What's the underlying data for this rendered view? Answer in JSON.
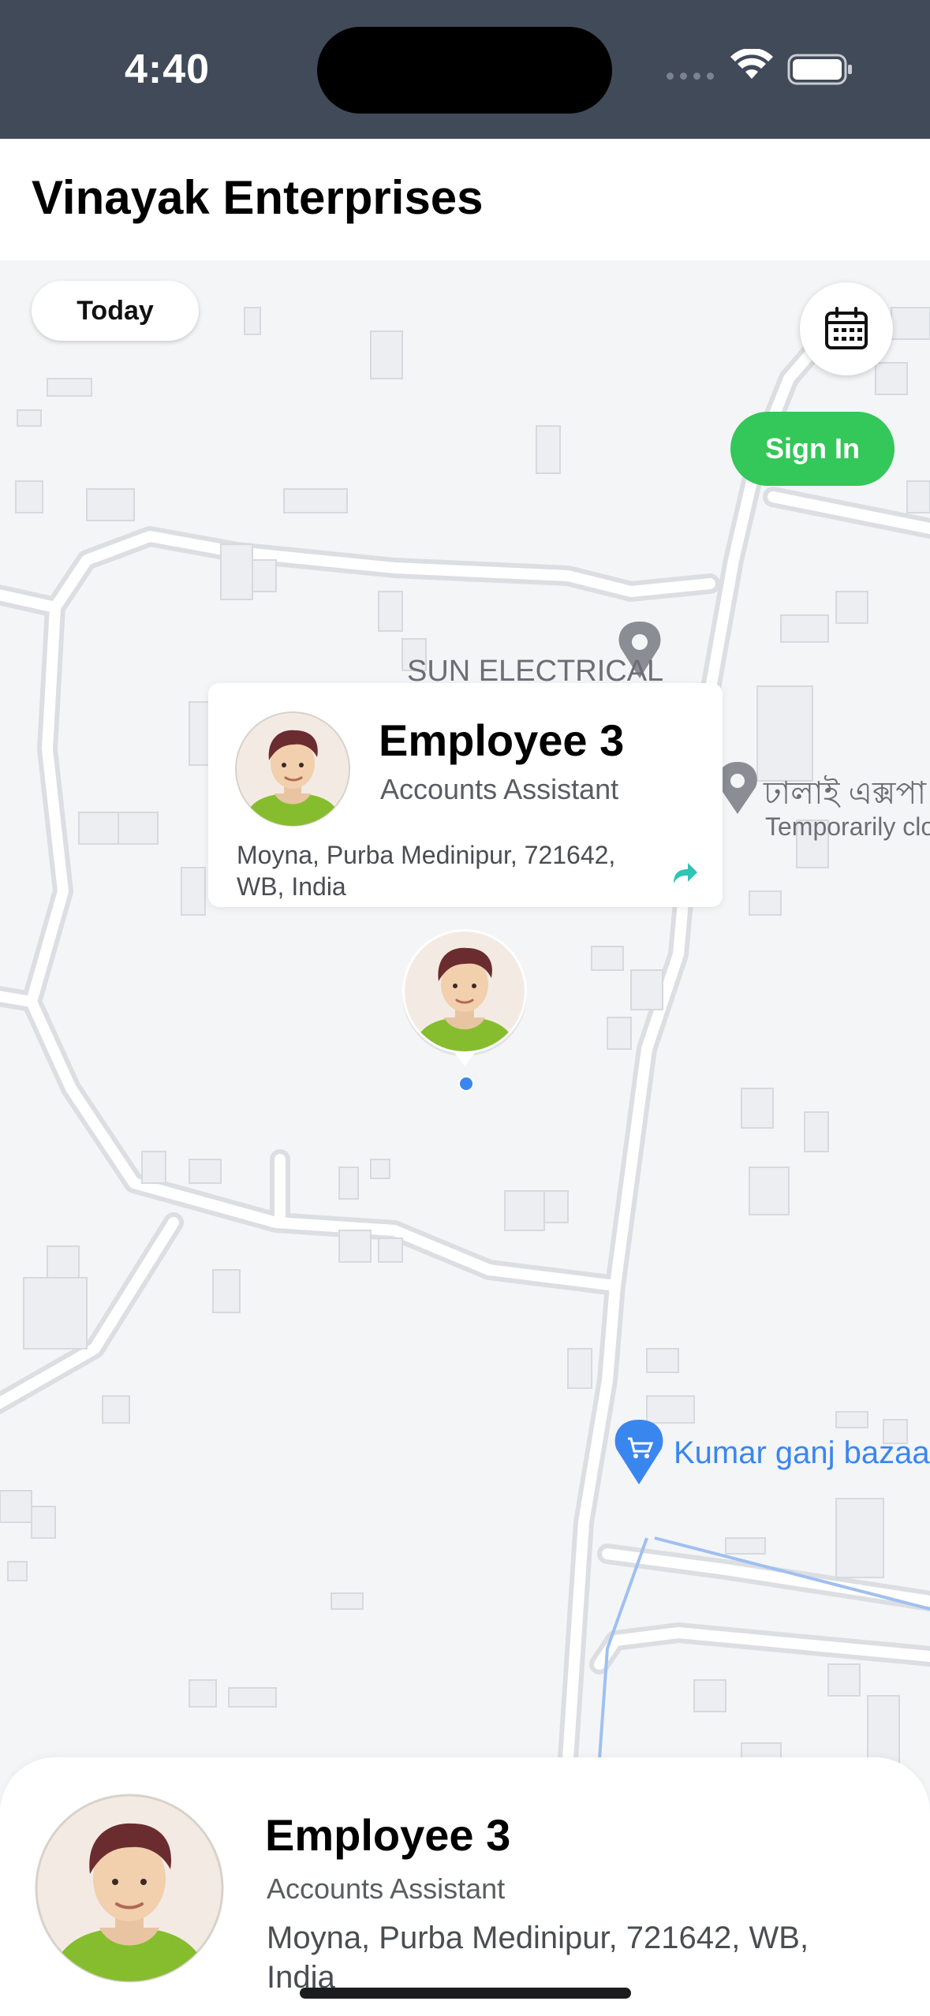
{
  "status_bar": {
    "time": "4:40"
  },
  "app_bar": {
    "title": "Vinayak Enterprises"
  },
  "map": {
    "today_label": "Today",
    "calendar_icon": "calendar-icon",
    "sign_in_label": "Sign In",
    "labels": {
      "sun_electrical": "SUN ELECTRICAL",
      "bengali_place": "ঢালাই এক্সপা",
      "bengali_status": "Temporarily clo",
      "market": "Kumar ganj bazaar"
    }
  },
  "callout": {
    "name": "Employee 3",
    "role": "Accounts Assistant",
    "address": "Moyna, Purba Medinipur, 721642, WB, India",
    "share_icon": "share-arrow-icon"
  },
  "sheet": {
    "name": "Employee 3",
    "role": "Accounts Assistant",
    "address": "Moyna, Purba Medinipur, 721642, WB, India"
  },
  "colors": {
    "accent_green": "#34c759",
    "status_bar_bg": "#414a58",
    "share_teal": "#2ec4b6",
    "pin_blue": "#3a86ef"
  }
}
